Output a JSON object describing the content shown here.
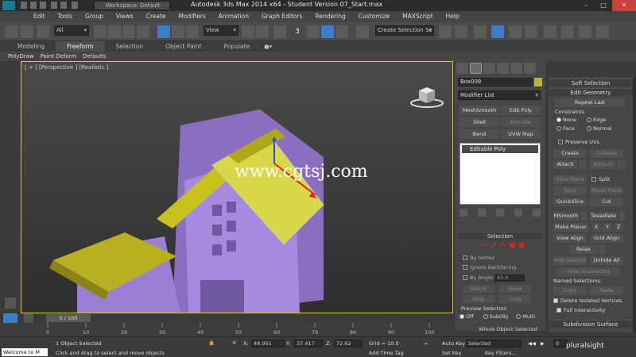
{
  "titlebar": {
    "workspace": "Workspace: Default",
    "title": "Autodesk 3ds Max  2014 x64  - Student Version    07_Start.max",
    "minimize": "–",
    "maximize": "□",
    "close": "✕"
  },
  "menu": [
    "Edit",
    "Tools",
    "Group",
    "Views",
    "Create",
    "Modifiers",
    "Animation",
    "Graph Editors",
    "Rendering",
    "Customize",
    "MAXScript",
    "Help"
  ],
  "toolbar": {
    "filter": "All",
    "ref_coord": "View",
    "snap_label": "3",
    "named_selection_placeholder": "Create Selection Se"
  },
  "ribbon": {
    "tabs": [
      "Modeling",
      "Freeform",
      "Selection",
      "Object Paint",
      "Populate"
    ],
    "active_tab": "Freeform",
    "subtabs": [
      "PolyDraw",
      "Paint Deform",
      "Defaults"
    ]
  },
  "viewport": {
    "label": "[ + ] [Perspective ] [Realistic ]",
    "watermark": "www.cgtsj.com",
    "colors": {
      "border": "#e8c23a",
      "walls": "#9b7fd4",
      "roof": "#c8c21e"
    }
  },
  "command_panel": {
    "object_name": "Box008",
    "object_color": "#c0b040",
    "modifier_list": "Modifier List",
    "modifier_buttons": [
      {
        "label": "MeshSmooth",
        "enabled": true
      },
      {
        "label": "Edit Poly",
        "enabled": true
      },
      {
        "label": "Shell",
        "enabled": true
      },
      {
        "label": "Extrude",
        "enabled": false
      },
      {
        "label": "Bend",
        "enabled": true
      },
      {
        "label": "UVW Map",
        "enabled": true
      }
    ],
    "stack_item": "Editable Poly",
    "selection": {
      "title": "Selection",
      "by_vertex": "By Vertex",
      "ignore_backfacing": "Ignore Backfacing",
      "by_angle": "By Angle:",
      "angle_value": "45.0",
      "shrink": "Shrink",
      "grow": "Grow",
      "ring": "Ring",
      "loop": "Loop",
      "preview_title": "Preview Selection",
      "preview_off": "Off",
      "preview_subobj": "SubObj",
      "preview_multi": "Multi",
      "status": "Whole Object Selected"
    }
  },
  "edit_geometry": {
    "soft_selection": "Soft Selection",
    "title": "Edit Geometry",
    "repeat_last": "Repeat Last",
    "constraints": "Constraints",
    "c_none": "None",
    "c_edge": "Edge",
    "c_face": "Face",
    "c_normal": "Normal",
    "preserve_uvs": "Preserve UVs",
    "create": "Create",
    "collapse": "Collapse",
    "attach": "Attach",
    "detach": "Detach",
    "slice_plane": "Slice Plane",
    "split": "Split",
    "slice": "Slice",
    "reset_plane": "Reset Plane",
    "quickslice": "QuickSlice",
    "cut": "Cut",
    "msmooth": "MSmooth",
    "tessellate": "Tessellate",
    "make_planar": "Make Planar",
    "x": "X",
    "y": "Y",
    "z": "Z",
    "view_align": "View Align",
    "grid_align": "Grid Align",
    "relax": "Relax",
    "hide_selected": "Hide Selected",
    "unhide_all": "Unhide All",
    "hide_unselected": "Hide Unselected",
    "named_selections": "Named Selections:",
    "copy": "Copy",
    "paste": "Paste",
    "delete_isolated": "Delete Isolated Vertices",
    "full_interactivity": "Full Interactivity",
    "subdivision_surface": "Subdivision Surface"
  },
  "timeline": {
    "slider": "0 / 100",
    "ticks": [
      "0",
      "10",
      "20",
      "30",
      "40",
      "50",
      "60",
      "70",
      "80",
      "90",
      "100"
    ]
  },
  "status": {
    "listener": "Welcome to M",
    "selected": "1 Object Selected",
    "prompt": "Click and drag to select and move objects",
    "x_label": "X:",
    "x_value": "48.951",
    "y_label": "Y:",
    "y_value": "37.417",
    "z_label": "Z:",
    "z_value": "72.62",
    "grid": "Grid = 10.0",
    "add_time_tag": "Add Time Tag",
    "auto_key": "Auto Key",
    "set_key": "Set Key",
    "key_mode": "Selected",
    "key_filters": "Key Filters...",
    "frame": "0",
    "brand": "pluralsight"
  }
}
